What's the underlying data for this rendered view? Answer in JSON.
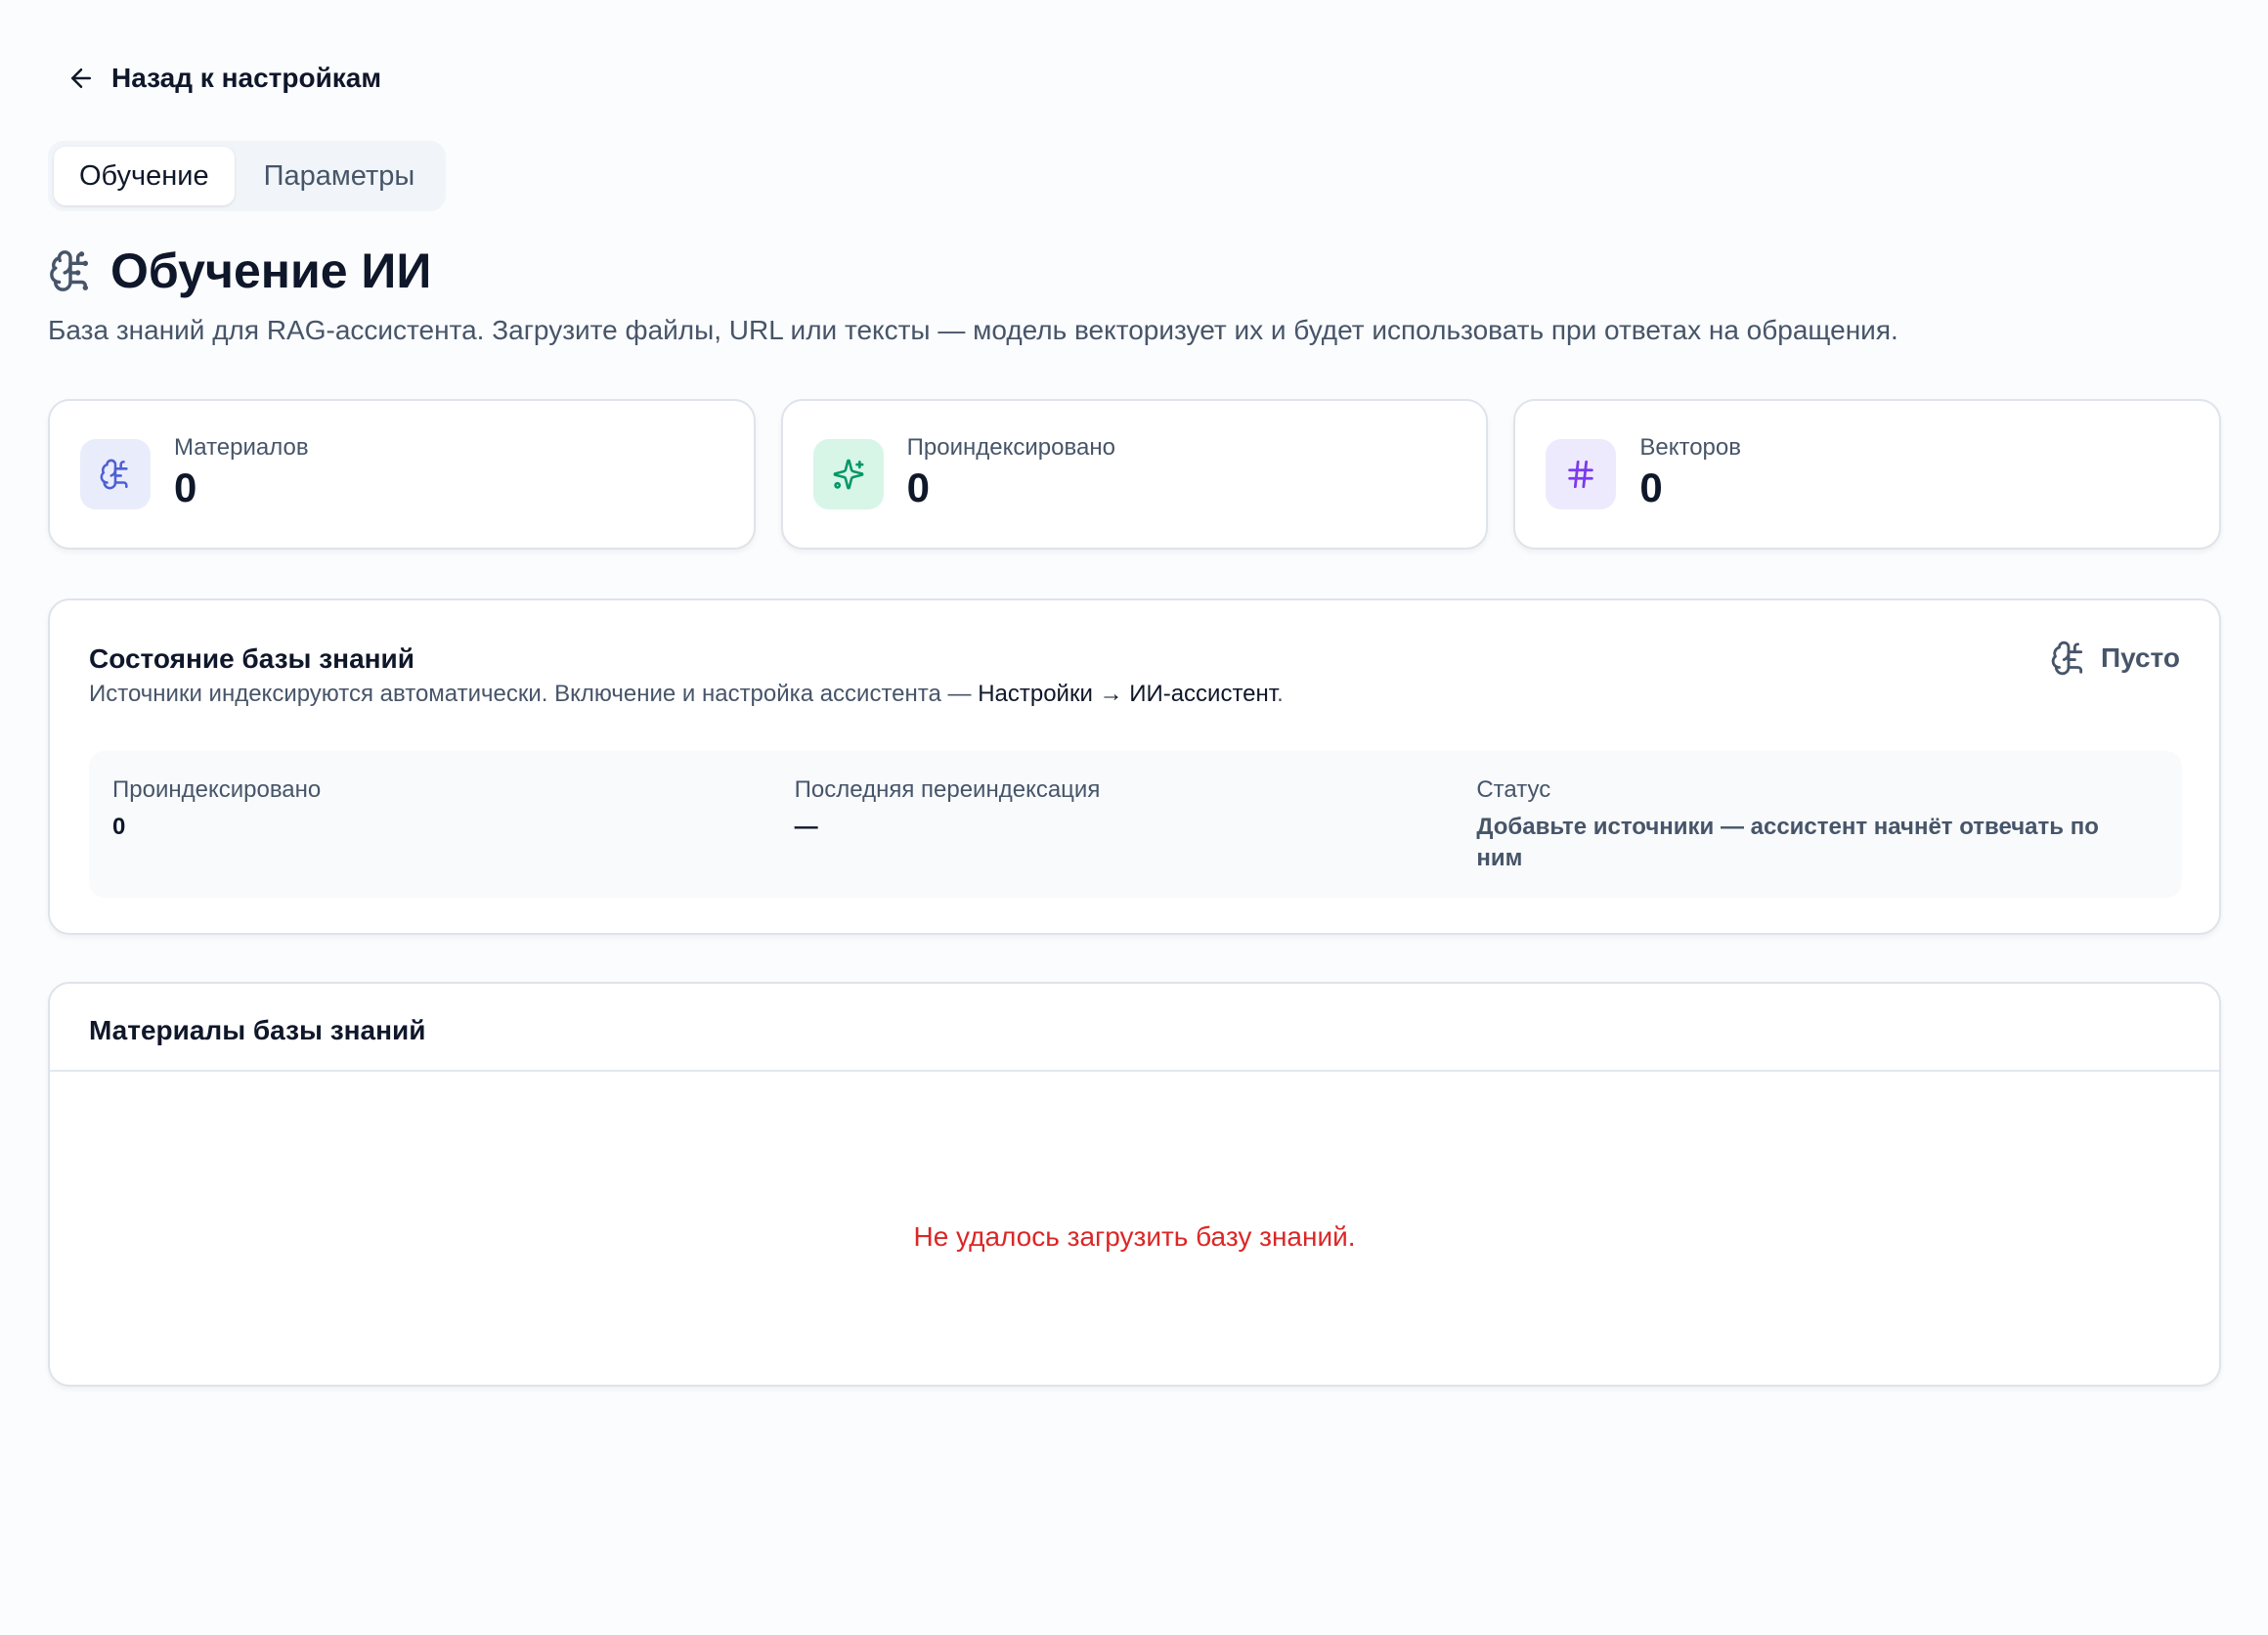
{
  "back_link": {
    "label": "Назад к настройкам",
    "icon": "arrow-left-icon"
  },
  "tabs": [
    {
      "label": "Обучение",
      "active": true
    },
    {
      "label": "Параметры",
      "active": false
    }
  ],
  "header": {
    "icon": "brain-icon",
    "title": "Обучение ИИ",
    "subtitle": "База знаний для RAG-ассистента. Загрузите файлы, URL или тексты — модель векторизует их и будет использовать при ответах на обращения."
  },
  "stats": [
    {
      "label": "Материалов",
      "value": "0",
      "icon": "brain-icon",
      "color": "#4f5fd6"
    },
    {
      "label": "Проиндексировано",
      "value": "0",
      "icon": "sparkles-icon",
      "color": "#059669"
    },
    {
      "label": "Векторов",
      "value": "0",
      "icon": "hash-icon",
      "color": "#7c3aed"
    }
  ],
  "knowledge_state": {
    "title": "Состояние базы знаний",
    "description_prefix": "Источники индексируются автоматически. Включение и настройка ассистента — ",
    "description_link": "Настройки → ИИ-ассистент",
    "description_suffix": ".",
    "badge": {
      "label": "Пусто",
      "icon": "brain-icon"
    },
    "details": {
      "indexed_label": "Проиндексировано",
      "indexed_value": "0",
      "last_reindex_label": "Последняя переиндексация",
      "last_reindex_value": "—",
      "status_label": "Статус",
      "status_value": "Добавьте источники — ассистент начнёт отвечать по ним"
    }
  },
  "materials": {
    "title": "Материалы базы знаний",
    "error": "Не удалось загрузить базу знаний."
  },
  "colors": {
    "background": "#fbfcfe",
    "text": "#0f172a",
    "muted": "#475569",
    "border": "#dfe3ea",
    "error": "#dc2626"
  }
}
